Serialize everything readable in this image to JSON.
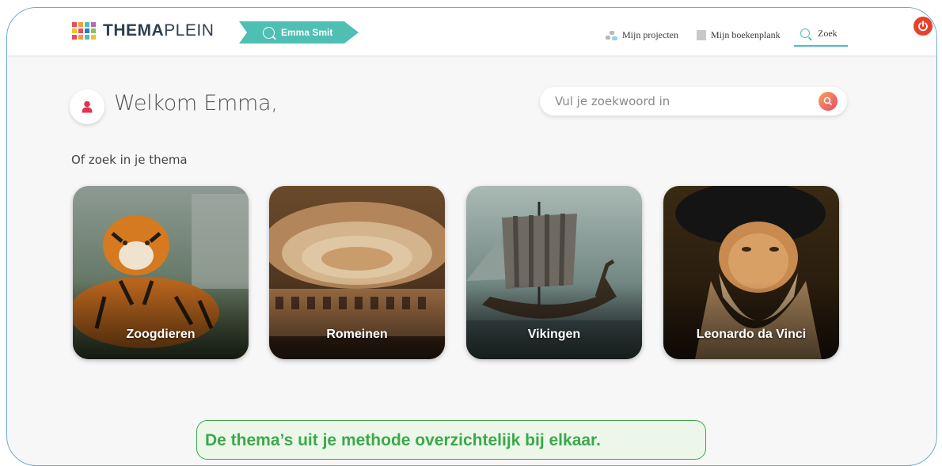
{
  "app": {
    "logo_bold": "THEMA",
    "logo_light": "PLEIN",
    "user_name": "Emma Smit"
  },
  "nav": {
    "projects_label": "Mijn projecten",
    "bookshelf_label": "Mijn boekenplank",
    "search_label": "Zoek"
  },
  "main": {
    "welcome": "Welkom Emma,",
    "search_placeholder": "Vul je zoekwoord in",
    "subtitle": "Of zoek in je thema"
  },
  "themes": [
    {
      "label": "Zoogdieren",
      "image": "tiger"
    },
    {
      "label": "Romeinen",
      "image": "colosseum"
    },
    {
      "label": "Vikingen",
      "image": "viking-ship"
    },
    {
      "label": "Leonardo da Vinci",
      "image": "portrait"
    }
  ],
  "caption": "De thema’s uit je methode overzichtelijk bij elkaar.",
  "colors": {
    "accent": "#4fbfb3",
    "power": "#e8412b",
    "frame": "#6fa9d3",
    "caption": "#3ca84a"
  },
  "icons": {
    "user": "user-icon",
    "search": "search-icon",
    "projects": "projects-icon",
    "bookshelf": "bookshelf-icon",
    "power": "power-icon"
  }
}
